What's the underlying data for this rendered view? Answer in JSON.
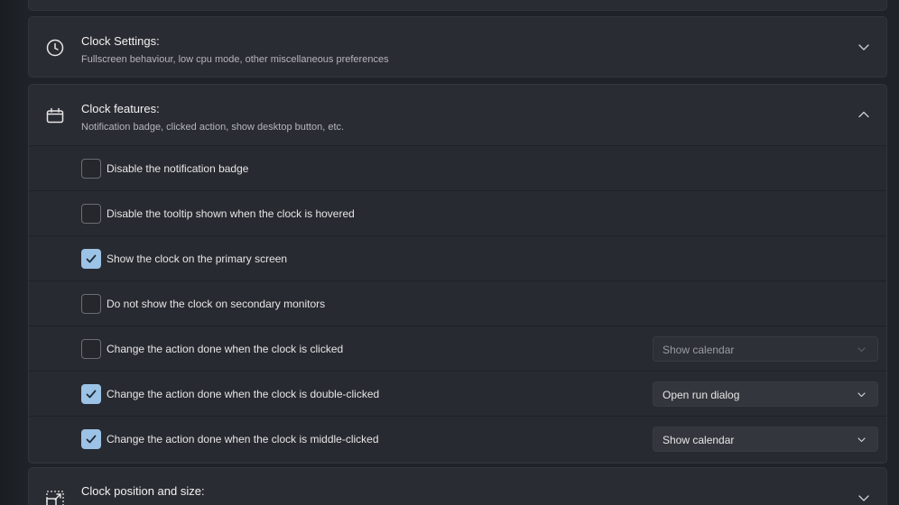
{
  "clock_settings": {
    "title": "Clock Settings:",
    "subtitle": "Fullscreen behaviour, low cpu mode, other miscellaneous preferences",
    "icon": "clock-icon",
    "expanded": false
  },
  "clock_features": {
    "title": "Clock features:",
    "subtitle": "Notification badge, clicked action, show desktop button, etc.",
    "icon": "calendar-icon",
    "expanded": true,
    "options": [
      {
        "label": "Disable the notification badge",
        "checked": false
      },
      {
        "label": "Disable the tooltip shown when the clock is hovered",
        "checked": false
      },
      {
        "label": "Show the clock on the primary screen",
        "checked": true
      },
      {
        "label": "Do not show the clock on secondary monitors",
        "checked": false
      },
      {
        "label": "Change the action done when the clock is clicked",
        "checked": false,
        "select_value": "Show calendar",
        "select_disabled": true
      },
      {
        "label": "Change the action done when the clock is double-clicked",
        "checked": true,
        "select_value": "Open run dialog",
        "select_disabled": false
      },
      {
        "label": "Change the action done when the clock is middle-clicked",
        "checked": true,
        "select_value": "Show calendar",
        "select_disabled": false
      }
    ]
  },
  "clock_position": {
    "title": "Clock position and size:",
    "icon": "resize-icon",
    "expanded": false
  },
  "colors": {
    "accent": "#9cc3e6",
    "card": "#2a2c33",
    "background": "#1f2228"
  }
}
